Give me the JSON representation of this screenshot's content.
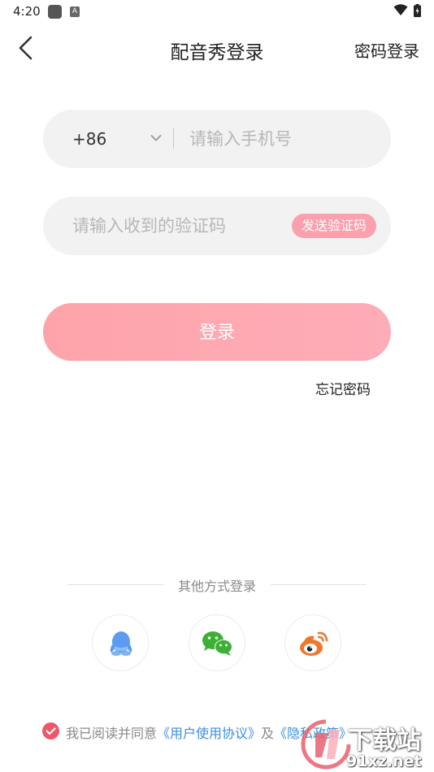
{
  "status_bar": {
    "time": "4:20",
    "notification_icons": [
      "app-icon",
      "a-icon"
    ],
    "a_icon_letter": "A",
    "right_icons": [
      "wifi-icon",
      "battery-icon"
    ]
  },
  "header": {
    "title": "配音秀登录",
    "right_action": "密码登录"
  },
  "form": {
    "country_code": "+86",
    "phone_placeholder": "请输入手机号",
    "code_placeholder": "请输入收到的验证码",
    "send_code_label": "发送验证码",
    "login_label": "登录",
    "forgot_password": "忘记密码"
  },
  "other_login": {
    "label": "其他方式登录",
    "providers": [
      "qq-icon",
      "wechat-icon",
      "weibo-icon"
    ]
  },
  "agreement": {
    "checked": true,
    "prefix": "我已阅读并同意",
    "user_agreement": "《用户使用协议》",
    "connector": "及",
    "privacy_policy": "《隐私政策》"
  },
  "watermark": {
    "brand": "下载站",
    "url": "91xz.net"
  },
  "colors": {
    "accent_pink": "#fba0ac",
    "check_red": "#f0566a",
    "link_blue": "#3d8fdd",
    "field_bg": "#f2f2f2",
    "qq_blue": "#5b9cf2",
    "wechat_green": "#3cb034",
    "weibo_orange": "#f0762a"
  }
}
